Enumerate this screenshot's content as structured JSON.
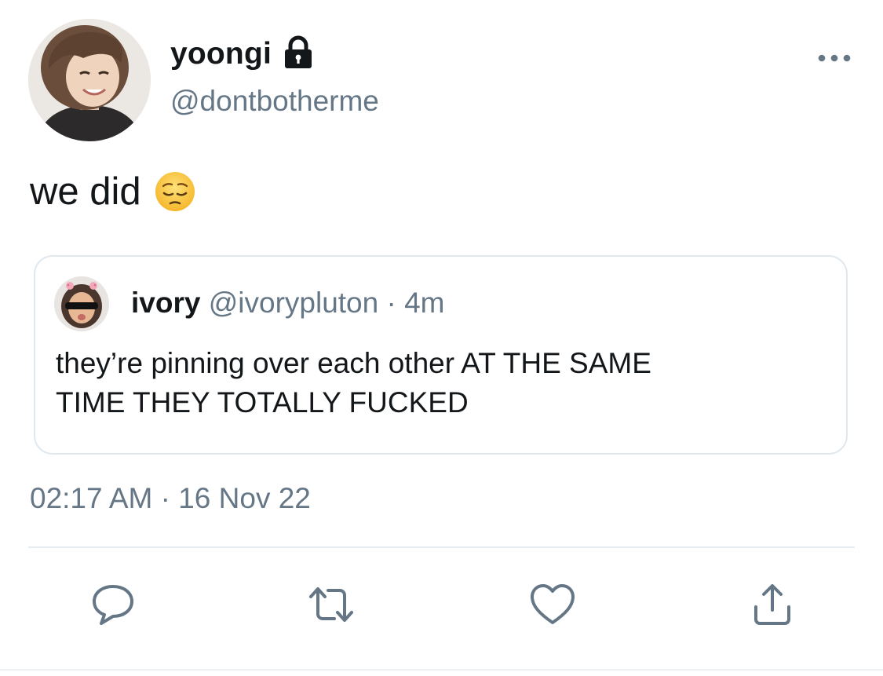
{
  "tweet": {
    "author": {
      "display_name": "yoongi",
      "handle": "@dontbotherme",
      "protected_icon": "lock-icon",
      "avatar": "profile-photo"
    },
    "more_icon": "more-options-icon",
    "text": "we did",
    "emoji_icon": "pensive-face-emoji",
    "timestamp": "02:17 AM · 16 Nov 22"
  },
  "quoted_tweet": {
    "display_name": "ivory",
    "handle_and_time": "@ivorypluton · 4m",
    "avatar": "profile-photo",
    "text_line1": "they’re pinning over each other AT THE SAME",
    "text_line2": "TIME THEY TOTALLY FUCKED"
  },
  "actions": [
    {
      "name": "reply",
      "icon": "reply-icon"
    },
    {
      "name": "retweet",
      "icon": "retweet-icon"
    },
    {
      "name": "like",
      "icon": "heart-icon"
    },
    {
      "name": "share",
      "icon": "share-icon"
    }
  ],
  "colors": {
    "primary_text": "#14171a",
    "secondary_text": "#657786",
    "border": "#e1e8ed",
    "icon": "#657786"
  }
}
